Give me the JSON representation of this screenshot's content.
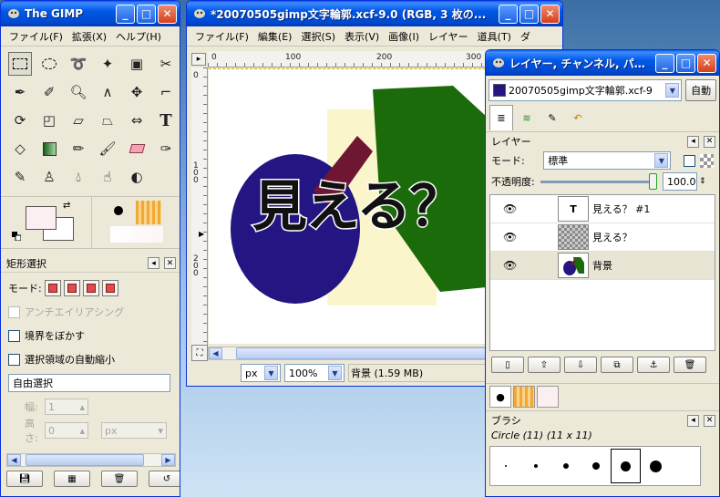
{
  "toolbox": {
    "title": "The GIMP",
    "menu": [
      "ファイル(F)",
      "拡張(X)",
      "ヘルプ(H)"
    ],
    "tool_options": {
      "title": "矩形選択",
      "mode_label": "モード:",
      "antialias": "アンチエイリアシング",
      "feather": "境界をぼかす",
      "autoshrink": "選択領域の自動縮小",
      "select_mode": "自由選択",
      "width_label": "幅:",
      "width_value": "1",
      "height_label": "高さ:",
      "height_value": "0",
      "unit": "px"
    }
  },
  "image_window": {
    "title": "*20070505gimp文字輪郭.xcf-9.0 (RGB, 3 枚の...",
    "menu": [
      "ファイル(F)",
      "編集(E)",
      "選択(S)",
      "表示(V)",
      "画像(I)",
      "レイヤー",
      "道具(T)",
      "ダ"
    ],
    "ruler_h": [
      "0",
      "100",
      "200",
      "300"
    ],
    "ruler_v": [
      "0",
      "1 0 0",
      "2 0 0"
    ],
    "canvas_text": "見える？",
    "unit": "px",
    "zoom": "100%",
    "status": "背景 (1.59 MB)"
  },
  "layers_window": {
    "title": "レイヤー, チャンネル, パス...",
    "image_select": "20070505gimp文字輪郭.xcf-9",
    "auto_button": "自動",
    "panel_title": "レイヤー",
    "mode_label": "モード:",
    "mode_value": "標準",
    "opacity_label": "不透明度:",
    "opacity_value": "100.0",
    "layers": [
      {
        "name": "見える？ #1"
      },
      {
        "name": "見える？"
      },
      {
        "name": "背景"
      }
    ],
    "brushes_title": "ブラシ",
    "brush_name": "Circle (11) (11 x 11)"
  },
  "colors": {
    "xp_blue": "#0058e6",
    "fg_color": "#fbeff2",
    "ellipse": "#231682",
    "cream": "#fbf5cc",
    "green": "#1b6b0b",
    "maroon": "#6e1632"
  }
}
